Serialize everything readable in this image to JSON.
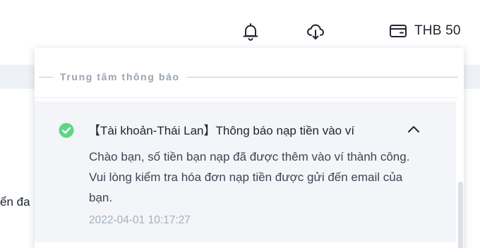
{
  "topbar": {
    "bell_icon": "bell-icon",
    "download_icon": "cloud-download-icon",
    "wallet_icon": "wallet-icon",
    "wallet_amount": "THB 50"
  },
  "background": {
    "partial_text": "ển đa"
  },
  "notifications": {
    "header_title": "Trung tâm thông báo",
    "items": [
      {
        "status_icon": "check-circle-icon",
        "title": "【Tài khoản-Thái Lan】Thông báo nạp tiền vào ví",
        "body": "Chào bạn, số tiền bạn nạp đã được thêm vào ví thành công. Vui lòng kiểm tra hóa đơn nạp tiền được gửi đến email của bạn.",
        "timestamp": "2022-04-01 10:17:27",
        "toggle_icon": "chevron-up-icon"
      }
    ]
  },
  "colors": {
    "success": "#5cd686",
    "accent_text": "#1d2530",
    "muted": "#a6b0bd"
  }
}
